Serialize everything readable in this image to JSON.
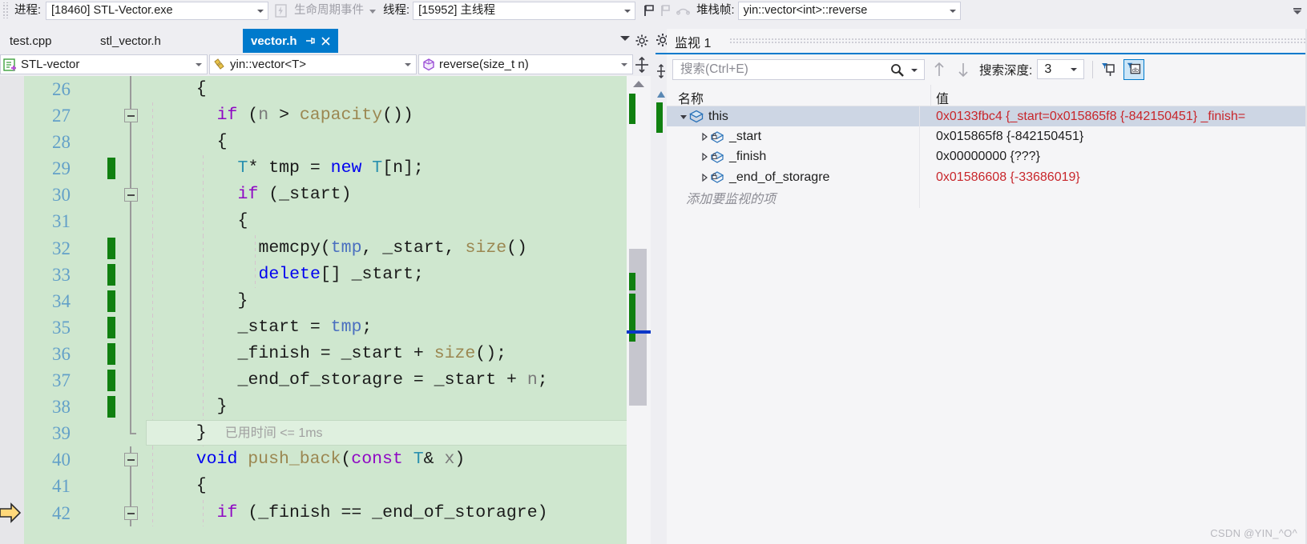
{
  "debug_toolbar": {
    "process_label": "进程:",
    "process_value": "[18460] STL-Vector.exe",
    "lifecycle_label": "生命周期事件",
    "thread_label": "线程:",
    "thread_value": "[15952] 主线程",
    "stack_label": "堆栈帧:",
    "stack_value": "yin::vector<int>::reverse"
  },
  "tabs": [
    {
      "label": "test.cpp",
      "active": false
    },
    {
      "label": "stl_vector.h",
      "active": false
    },
    {
      "label": "vector.h",
      "active": true
    }
  ],
  "navbar": {
    "project": "STL-vector",
    "class": "yin::vector<T>",
    "method": "reverse(size_t n)"
  },
  "code": {
    "lines": [
      {
        "num": "26",
        "indent": 5,
        "changed": false,
        "fold": "line",
        "guides": [],
        "tokens": [
          {
            "t": "{",
            "c": "id"
          }
        ]
      },
      {
        "num": "27",
        "indent": 7,
        "changed": false,
        "fold": "box",
        "guides": [
          "g1"
        ],
        "tokens": [
          {
            "t": "if",
            "c": "kw"
          },
          {
            "t": " (",
            "c": "id"
          },
          {
            "t": "n",
            "c": "param"
          },
          {
            "t": " > ",
            "c": "id"
          },
          {
            "t": "capacity",
            "c": "fn"
          },
          {
            "t": "())",
            "c": "id"
          }
        ]
      },
      {
        "num": "28",
        "indent": 7,
        "changed": false,
        "fold": "line",
        "guides": [
          "g1"
        ],
        "tokens": [
          {
            "t": "{",
            "c": "id"
          }
        ]
      },
      {
        "num": "29",
        "indent": 9,
        "changed": true,
        "fold": "line",
        "guides": [
          "g1",
          "g2"
        ],
        "tokens": [
          {
            "t": "T",
            "c": "typ"
          },
          {
            "t": "* tmp = ",
            "c": "id"
          },
          {
            "t": "new",
            "c": "kw2"
          },
          {
            "t": " ",
            "c": "id"
          },
          {
            "t": "T",
            "c": "typ"
          },
          {
            "t": "[n];",
            "c": "id"
          }
        ]
      },
      {
        "num": "30",
        "indent": 9,
        "changed": false,
        "fold": "box",
        "guides": [
          "g1",
          "g2"
        ],
        "tokens": [
          {
            "t": "if",
            "c": "kw"
          },
          {
            "t": " (_start)",
            "c": "id"
          }
        ]
      },
      {
        "num": "31",
        "indent": 9,
        "changed": false,
        "fold": "line",
        "guides": [
          "g1",
          "g2"
        ],
        "tokens": [
          {
            "t": "{",
            "c": "id"
          }
        ]
      },
      {
        "num": "32",
        "indent": 11,
        "changed": true,
        "fold": "line",
        "guides": [
          "g1",
          "g2",
          "g3"
        ],
        "tokens": [
          {
            "t": "memcpy",
            "c": "id"
          },
          {
            "t": "(",
            "c": "id"
          },
          {
            "t": "tmp",
            "c": "var"
          },
          {
            "t": ", _start, ",
            "c": "id"
          },
          {
            "t": "size",
            "c": "fn"
          },
          {
            "t": "()",
            "c": "id"
          }
        ]
      },
      {
        "num": "33",
        "indent": 11,
        "changed": true,
        "fold": "line",
        "guides": [
          "g1",
          "g2",
          "g3"
        ],
        "tokens": [
          {
            "t": "delete",
            "c": "kw2"
          },
          {
            "t": "[] _start;",
            "c": "id"
          }
        ]
      },
      {
        "num": "34",
        "indent": 9,
        "changed": true,
        "fold": "line",
        "guides": [
          "g1",
          "g2"
        ],
        "tokens": [
          {
            "t": "}",
            "c": "id"
          }
        ]
      },
      {
        "num": "35",
        "indent": 9,
        "changed": true,
        "fold": "line",
        "guides": [
          "g1",
          "g2"
        ],
        "tokens": [
          {
            "t": "_start = ",
            "c": "id"
          },
          {
            "t": "tmp",
            "c": "var"
          },
          {
            "t": ";",
            "c": "id"
          }
        ]
      },
      {
        "num": "36",
        "indent": 9,
        "changed": true,
        "fold": "line",
        "guides": [
          "g1",
          "g2"
        ],
        "tokens": [
          {
            "t": "_finish = _start + ",
            "c": "id"
          },
          {
            "t": "size",
            "c": "fn"
          },
          {
            "t": "();",
            "c": "id"
          }
        ]
      },
      {
        "num": "37",
        "indent": 9,
        "changed": true,
        "fold": "line",
        "guides": [
          "g1",
          "g2"
        ],
        "tokens": [
          {
            "t": "_end_of_storagre = _start + ",
            "c": "id"
          },
          {
            "t": "n",
            "c": "param"
          },
          {
            "t": ";",
            "c": "id"
          }
        ]
      },
      {
        "num": "38",
        "indent": 7,
        "changed": true,
        "fold": "line",
        "guides": [
          "g1",
          "g2"
        ],
        "tokens": [
          {
            "t": "}",
            "c": "id"
          }
        ]
      },
      {
        "num": "39",
        "indent": 5,
        "changed": false,
        "fold": "end",
        "guides": [
          "g1",
          "g2"
        ],
        "current": true,
        "tokens": [
          {
            "t": "}",
            "c": "id"
          }
        ]
      },
      {
        "num": "40",
        "indent": 5,
        "changed": false,
        "fold": "box",
        "guides": [
          "g1"
        ],
        "tokens": [
          {
            "t": "void",
            "c": "kw2"
          },
          {
            "t": " ",
            "c": "id"
          },
          {
            "t": "push_back",
            "c": "fn"
          },
          {
            "t": "(",
            "c": "id"
          },
          {
            "t": "const",
            "c": "kw"
          },
          {
            "t": " ",
            "c": "id"
          },
          {
            "t": "T",
            "c": "typ"
          },
          {
            "t": "& ",
            "c": "id"
          },
          {
            "t": "x",
            "c": "param"
          },
          {
            "t": ")",
            "c": "id"
          }
        ]
      },
      {
        "num": "41",
        "indent": 5,
        "changed": false,
        "fold": "line",
        "guides": [
          "g1"
        ],
        "tokens": [
          {
            "t": "{",
            "c": "id"
          }
        ]
      },
      {
        "num": "42",
        "indent": 7,
        "changed": false,
        "fold": "box",
        "guides": [
          "g1",
          "g2"
        ],
        "tokens": [
          {
            "t": "if",
            "c": "kw"
          },
          {
            "t": " (_finish == _end_of_storagre)",
            "c": "id"
          }
        ]
      }
    ],
    "perftip": "已用时间 <= 1ms"
  },
  "watch": {
    "title": "监视 1",
    "search_placeholder": "搜索(Ctrl+E)",
    "search_value": "",
    "depth_label": "搜索深度:",
    "depth_value": "3",
    "col_name": "名称",
    "col_value": "值",
    "add_row_text": "添加要监视的项",
    "rows": [
      {
        "name": "this",
        "value": "0x0133fbc4 {_start=0x015865f8 {-842150451} _finish=",
        "color": "red",
        "level": 0,
        "selected": true,
        "expanded": true
      },
      {
        "name": "_start",
        "value": "0x015865f8 {-842150451}",
        "color": "blk",
        "level": 1,
        "selected": false,
        "expanded": false
      },
      {
        "name": "_finish",
        "value": "0x00000000 {???}",
        "color": "blk",
        "level": 1,
        "selected": false,
        "expanded": false
      },
      {
        "name": "_end_of_storagre",
        "value": "0x01586608 {-33686019}",
        "color": "red",
        "level": 1,
        "selected": false,
        "expanded": false
      }
    ]
  },
  "watermark": "CSDN @YIN_^O^",
  "colors": {
    "accent": "#007ACC",
    "code_bg": "#CFE7CF",
    "change_bar": "#108010",
    "value_red": "#C8262B",
    "linenum": "#63A0C8"
  }
}
